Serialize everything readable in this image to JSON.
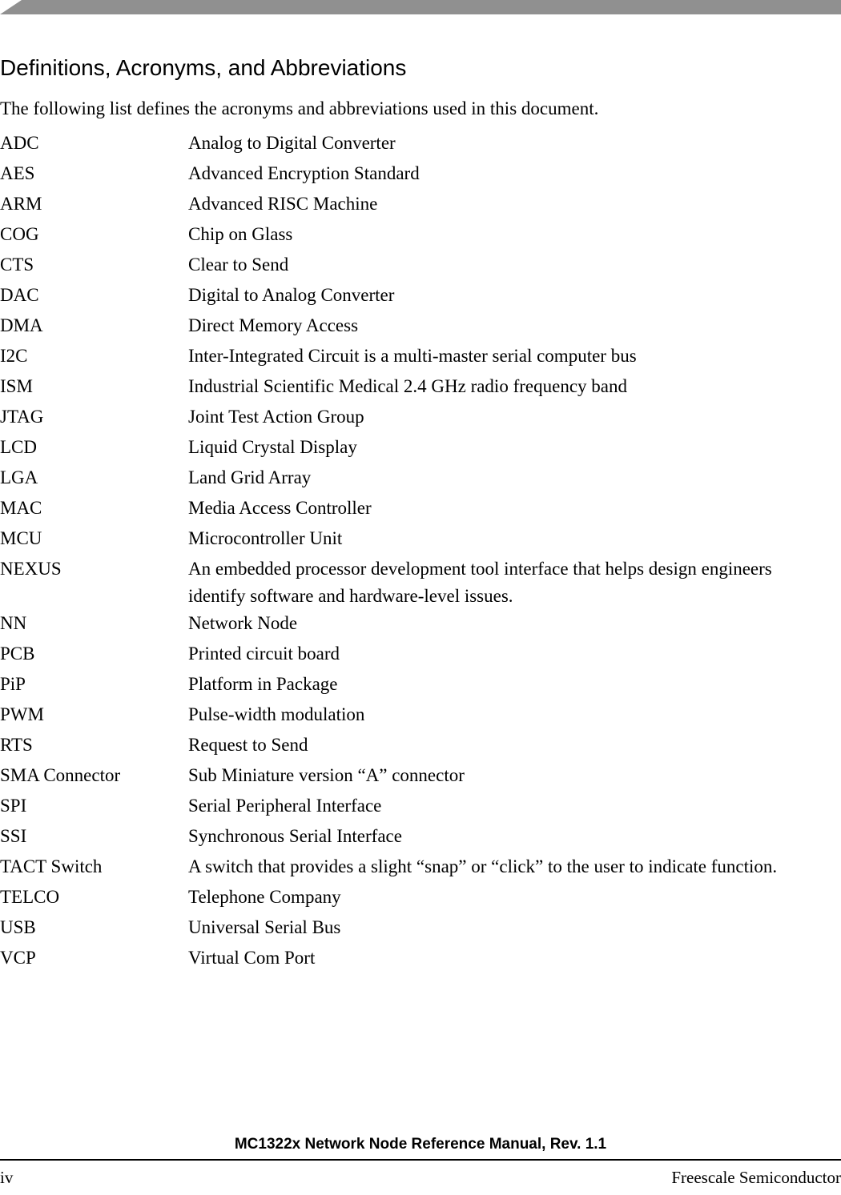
{
  "header": {
    "bar_color": "#909090"
  },
  "document": {
    "title": "Definitions, Acronyms, and Abbreviations",
    "intro": "The following list defines the acronyms and abbreviations used in this document."
  },
  "glossary": [
    {
      "term": "ADC",
      "definition": [
        "Analog to Digital Converter"
      ]
    },
    {
      "term": "AES",
      "definition": [
        "Advanced Encryption Standard"
      ]
    },
    {
      "term": "ARM",
      "definition": [
        "Advanced RISC Machine"
      ]
    },
    {
      "term": "COG",
      "definition": [
        "Chip on Glass"
      ]
    },
    {
      "term": "CTS",
      "definition": [
        "Clear to Send"
      ]
    },
    {
      "term": "DAC",
      "definition": [
        "Digital to Analog Converter"
      ]
    },
    {
      "term": "DMA",
      "definition": [
        "Direct Memory Access"
      ]
    },
    {
      "term": "I2C",
      "definition": [
        "Inter-Integrated Circuit is a multi-master serial computer bus"
      ]
    },
    {
      "term": "ISM",
      "definition": [
        "Industrial Scientific Medical 2.4 GHz radio frequency band"
      ]
    },
    {
      "term": "JTAG",
      "definition": [
        "Joint Test Action Group"
      ]
    },
    {
      "term": "LCD",
      "definition": [
        "Liquid Crystal Display"
      ]
    },
    {
      "term": "LGA",
      "definition": [
        "Land Grid Array"
      ]
    },
    {
      "term": "MAC",
      "definition": [
        "Media Access Controller"
      ]
    },
    {
      "term": "MCU",
      "definition": [
        "Microcontroller Unit"
      ]
    },
    {
      "term": "NEXUS",
      "definition": [
        "An embedded processor development tool interface that helps design engineers",
        "identify software and hardware-level issues."
      ]
    },
    {
      "term": "NN",
      "definition": [
        "Network Node"
      ]
    },
    {
      "term": "PCB",
      "definition": [
        "Printed circuit board"
      ]
    },
    {
      "term": "PiP",
      "definition": [
        "Platform in Package"
      ]
    },
    {
      "term": "PWM",
      "definition": [
        "Pulse-width modulation"
      ]
    },
    {
      "term": "RTS",
      "definition": [
        "Request to Send"
      ]
    },
    {
      "term": "SMA Connector",
      "definition": [
        "Sub Miniature version “A” connector"
      ]
    },
    {
      "term": "SPI",
      "definition": [
        "Serial Peripheral Interface"
      ]
    },
    {
      "term": "SSI",
      "definition": [
        "Synchronous Serial Interface"
      ]
    },
    {
      "term": "TACT Switch",
      "definition": [
        "A switch that provides a slight “snap” or “click” to the user to indicate function."
      ]
    },
    {
      "term": "TELCO",
      "definition": [
        "Telephone Company"
      ]
    },
    {
      "term": "USB",
      "definition": [
        "Universal Serial Bus"
      ]
    },
    {
      "term": "VCP",
      "definition": [
        "Virtual Com Port"
      ]
    }
  ],
  "footer": {
    "title": "MC1322x Network Node Reference Manual, Rev. 1.1",
    "page_number": "iv",
    "company": "Freescale Semiconductor"
  }
}
